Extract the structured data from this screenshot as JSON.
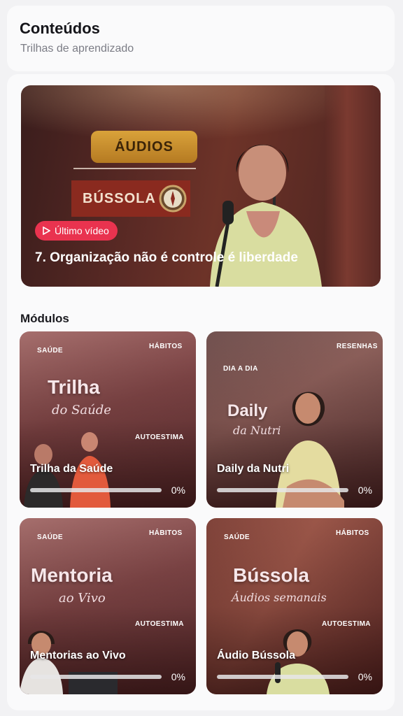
{
  "header": {
    "title": "Conteúdos",
    "subtitle": "Trilhas de aprendizado"
  },
  "featured": {
    "art_audios": "ÁUDIOS",
    "art_bussola": "BÚSSOLA",
    "badge": "Último vídeo",
    "title": "7. Organização não é controle é liberdade"
  },
  "modules": {
    "section_title": "Módulos",
    "items": [
      {
        "name": "Trilha da Saúde",
        "progress": 0,
        "progress_label": "0%",
        "art": {
          "tag1": "SAÚDE",
          "tag2": "HÁBITOS",
          "tag3": "AUTOESTIMA",
          "big": "Trilha",
          "script": "do Saúde"
        }
      },
      {
        "name": "Daily da Nutri",
        "progress": 0,
        "progress_label": "0%",
        "art": {
          "tag1": "DIA A DIA",
          "tag2": "RESENHAS",
          "big": "Daily",
          "script": "da Nutri"
        }
      },
      {
        "name": "Mentorias ao Vivo",
        "progress": 0,
        "progress_label": "0%",
        "art": {
          "tag1": "SAÚDE",
          "tag2": "HÁBITOS",
          "tag3": "AUTOESTIMA",
          "big": "Mentoria",
          "script": "ao Vivo"
        }
      },
      {
        "name": "Áudio Bússola",
        "progress": 0,
        "progress_label": "0%",
        "art": {
          "tag1": "SAÚDE",
          "tag2": "HÁBITOS",
          "tag3": "AUTOESTIMA",
          "big": "Bússola",
          "script": "Áudios semanais"
        }
      }
    ]
  },
  "colors": {
    "accent": "#e9334f",
    "background": "#f2f2f4"
  }
}
